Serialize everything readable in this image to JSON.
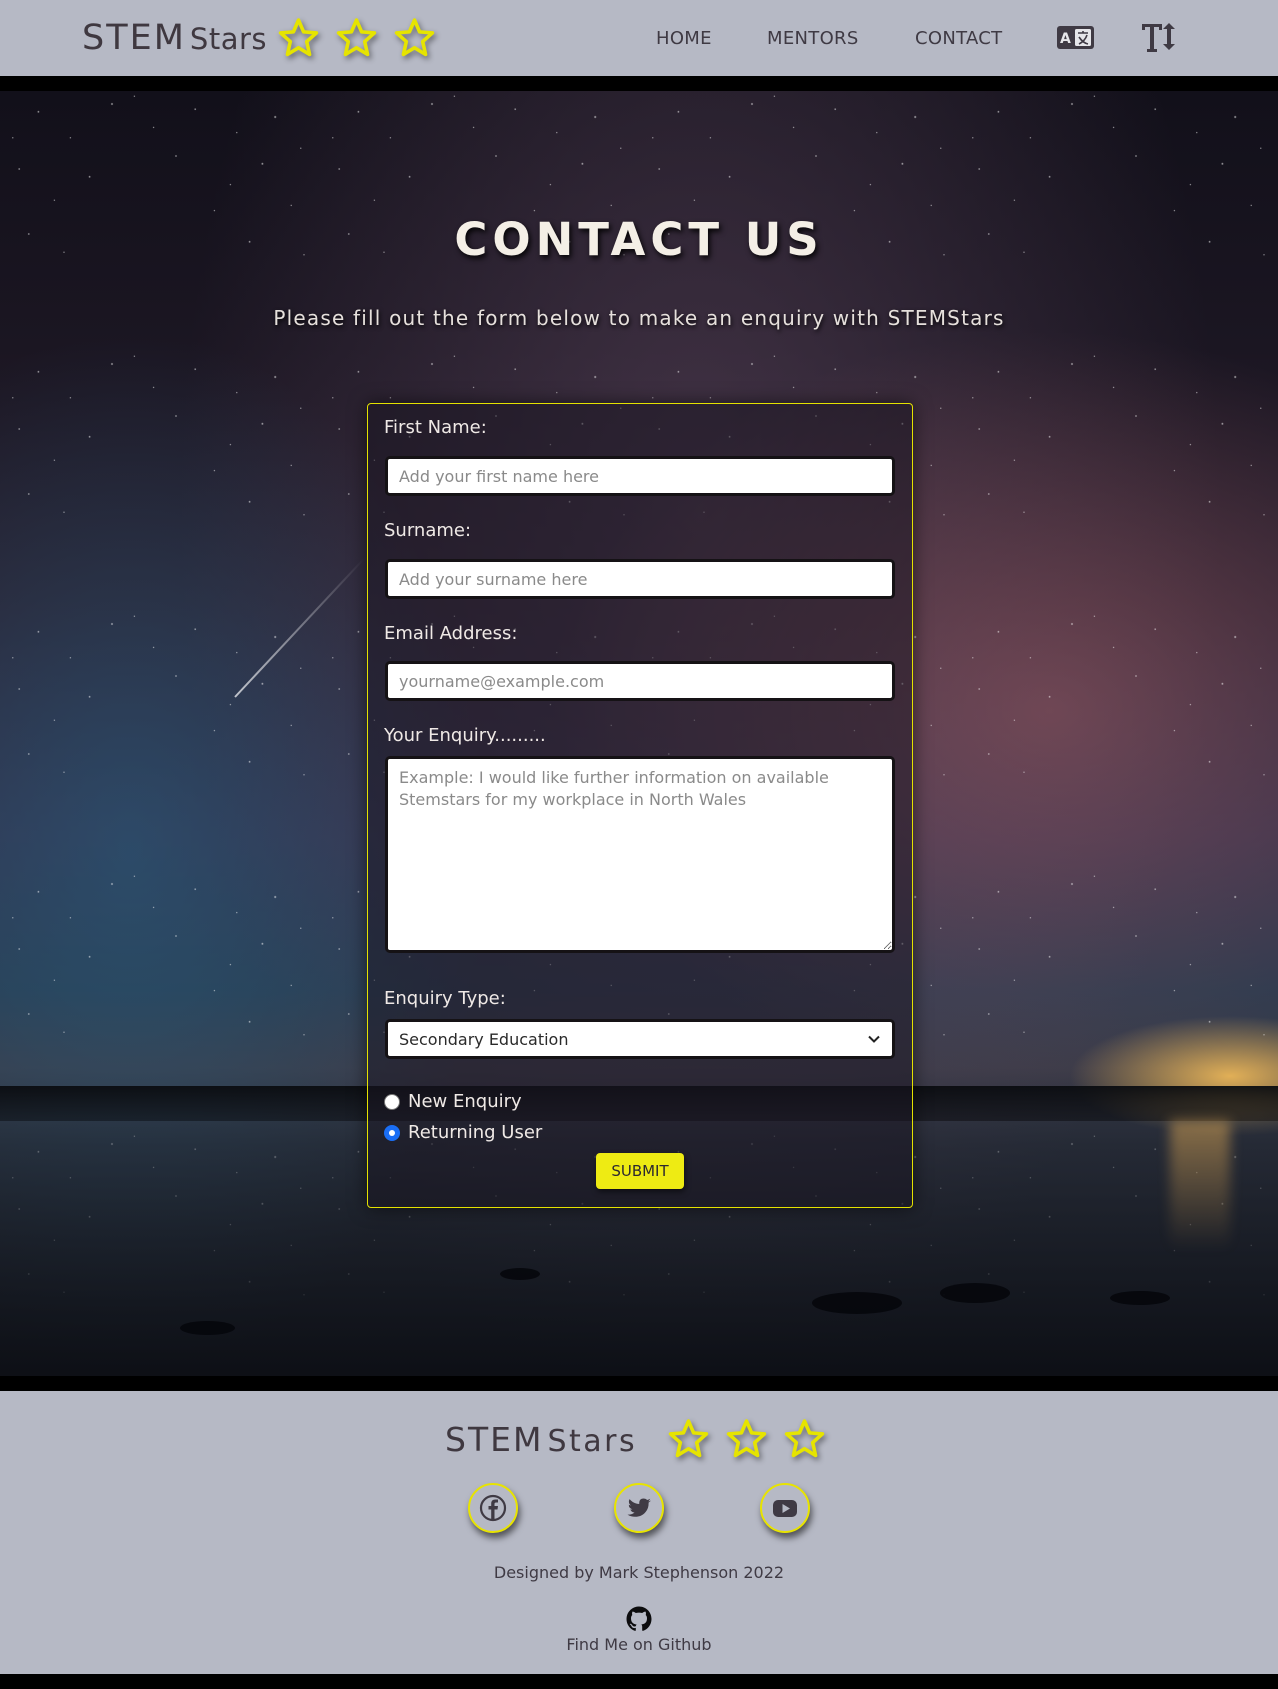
{
  "header": {
    "brand_bold": "STEM",
    "brand_light": "Stars",
    "nav": {
      "home": "HOME",
      "mentors": "MENTORS",
      "contact": "CONTACT"
    },
    "icons": [
      "star-icon",
      "star-icon",
      "star-icon",
      "translate-icon",
      "text-size-icon"
    ]
  },
  "hero": {
    "title": "CONTACT US",
    "subtitle": "Please fill out the form below to make an enquiry with STEMStars"
  },
  "form": {
    "first_name_label": "First Name:",
    "first_name_placeholder": "Add your first name here",
    "first_name_value": "",
    "surname_label": "Surname:",
    "surname_placeholder": "Add your surname here",
    "surname_value": "",
    "email_label": "Email Address:",
    "email_placeholder": "yourname@example.com",
    "email_value": "",
    "enquiry_label": "Your Enquiry.........",
    "enquiry_placeholder": "Example: I would like further information on available Stemstars for my workplace in North Wales",
    "enquiry_value": "",
    "type_label": "Enquiry Type:",
    "type_selected": "Secondary Education",
    "radio_new": "New Enquiry",
    "radio_returning": "Returning User",
    "radio_selected": "Returning User",
    "submit_label": "SUBMIT"
  },
  "footer": {
    "brand_bold": "STEM",
    "brand_light": "Stars",
    "credit": "Designed by Mark Stephenson 2022",
    "github_text": "Find Me on Github",
    "social_icons": [
      "facebook-icon",
      "twitter-icon",
      "youtube-icon",
      "github-icon"
    ]
  },
  "colors": {
    "bar_background": "#b6b9c5",
    "accent_yellow": "#eeeb13",
    "text_dark": "#3f3a44",
    "radio_selected": "#1a6ef5"
  }
}
